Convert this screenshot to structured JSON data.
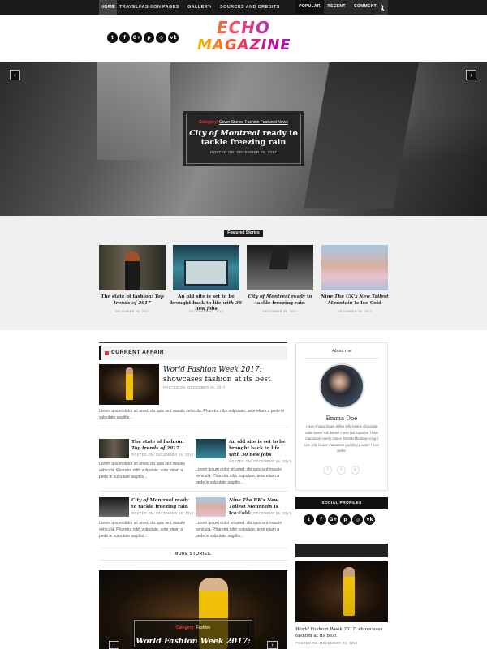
{
  "nav": {
    "items": [
      "HOME",
      "TRAVEL",
      "FASHION",
      "PAGES",
      "GALLERY",
      "SOURCES AND CREDITS"
    ],
    "dropdown_chevron": "▾",
    "search_icon": "search-icon"
  },
  "header": {
    "logo_line1": "ECHO",
    "logo_line2": "MAGAZINE",
    "social": [
      {
        "icon": "twitter-icon",
        "glyph": "t"
      },
      {
        "icon": "facebook-icon",
        "glyph": "f"
      },
      {
        "icon": "google-plus-icon",
        "glyph": "G+"
      },
      {
        "icon": "pinterest-icon",
        "glyph": "p"
      },
      {
        "icon": "instagram-icon",
        "glyph": "◎"
      },
      {
        "icon": "vk-icon",
        "glyph": "vk"
      }
    ]
  },
  "hero": {
    "category_label": "Category:",
    "categories": "Cover Stories Fashion Featured News",
    "title_italic": "City of Montreal",
    "title_rest": " ready to tackle freezing rain",
    "date": "POSTED ON: DECEMBER 26, 2017",
    "prev": "‹",
    "next": "›"
  },
  "featured": {
    "label": "Featured Stories",
    "items": [
      {
        "title_a": "The state of fashion: ",
        "title_b": "Top trends of 2017",
        "date": "DECEMBER 26, 2017"
      },
      {
        "title_a": "An old site is set to be brought back to life ",
        "title_b": "with 30 new jobs",
        "date": "DECEMBER 26, 2017"
      },
      {
        "title_a": "City of Montreal ",
        "title_b": "ready to tackle freezing rain",
        "date": "DECEMBER 26, 2017"
      },
      {
        "title_a": "Nine The UK's New Tallest Mountain",
        "title_b": " Is Ice Cold",
        "date": "DECEMBER 26, 2017"
      }
    ]
  },
  "current_affair": {
    "heading": "CURRENT AFFAIR",
    "main": {
      "title_italic": "World Fashion Week 2017:",
      "title_rest": "showcases fashion at its best",
      "posted": "POSTED ON: DECEMBER 26, 2017",
      "excerpt": "Lorem ipsum dolor sit amet, dis quis sed mauris vehicula. Pharetra nibh vulputate, ante etiam a pede in vulputate sagittis..."
    },
    "posts": [
      {
        "title_a": "The state of fashion: ",
        "title_b": "Top trends of 2017",
        "posted": "POSTED ON: DECEMBER 26, 2017",
        "excerpt": "Lorem ipsum dolor sit amet, dis quis sed mauris vehicula. Pharetra nibh vulputate, ante etiam a pede in vulputate sagittis..."
      },
      {
        "title_a": "An old site is set to be brought back to life ",
        "title_b": "with 30 new jobs",
        "posted": "POSTED ON: DECEMBER 26, 2017",
        "excerpt": "Lorem ipsum dolor sit amet, dis quis sed mauris vehicula. Pharetra nibh vulputate, ante etiam a pede in vulputate sagittis..."
      },
      {
        "title_a": "City of Montreal ",
        "title_b": "ready to tackle freezing rain",
        "posted": "POSTED ON: DECEMBER 26, 2017",
        "excerpt": "Lorem ipsum dolor sit amet, dis quis sed mauris vehicula. Pharetra nibh vulputate, ante etiam a pede in vulputate sagittis..."
      },
      {
        "title_a": "Nine The UK's New Tallest Mountain",
        "title_b": " Is Ice Cold",
        "posted": "POSTED ON: DECEMBER 26, 2017",
        "excerpt": "Lorem ipsum dolor sit amet, dis quis sed mauris vehicula. Pharetra nibh vulputate, ante etiam a pede in vulputate sagittis..."
      }
    ],
    "more": "MORE STORIES."
  },
  "bottom_feature": {
    "category_label": "Category:",
    "category": "Fashion",
    "title": "World Fashion Week 2017:",
    "prev": "‹",
    "next": "›"
  },
  "sidebar": {
    "about_heading": "About me",
    "name": "Emma Doe",
    "bio": "I love chupa chups toffee jelly beans chocolate cake sweet roll danish I love tart liquorice I love macaroon candy canes. Dessert bonbon icing I love jelly beans macaroon pudding powder I love wafer.",
    "about_social": [
      "f",
      "t",
      "p"
    ],
    "social_profiles_heading": "SOCIAL PROFILES",
    "tabs": [
      "POPULAR",
      "RECENT",
      "COMMENT"
    ],
    "post_title_italic": "World Fashion Week 2017:",
    "post_title_rest": " showcases fashion at its best",
    "post_posted": "POSTED ON: DECEMBER 26, 2017"
  },
  "colors": {
    "accent": "#e33333",
    "dark": "#1a1a1a"
  }
}
